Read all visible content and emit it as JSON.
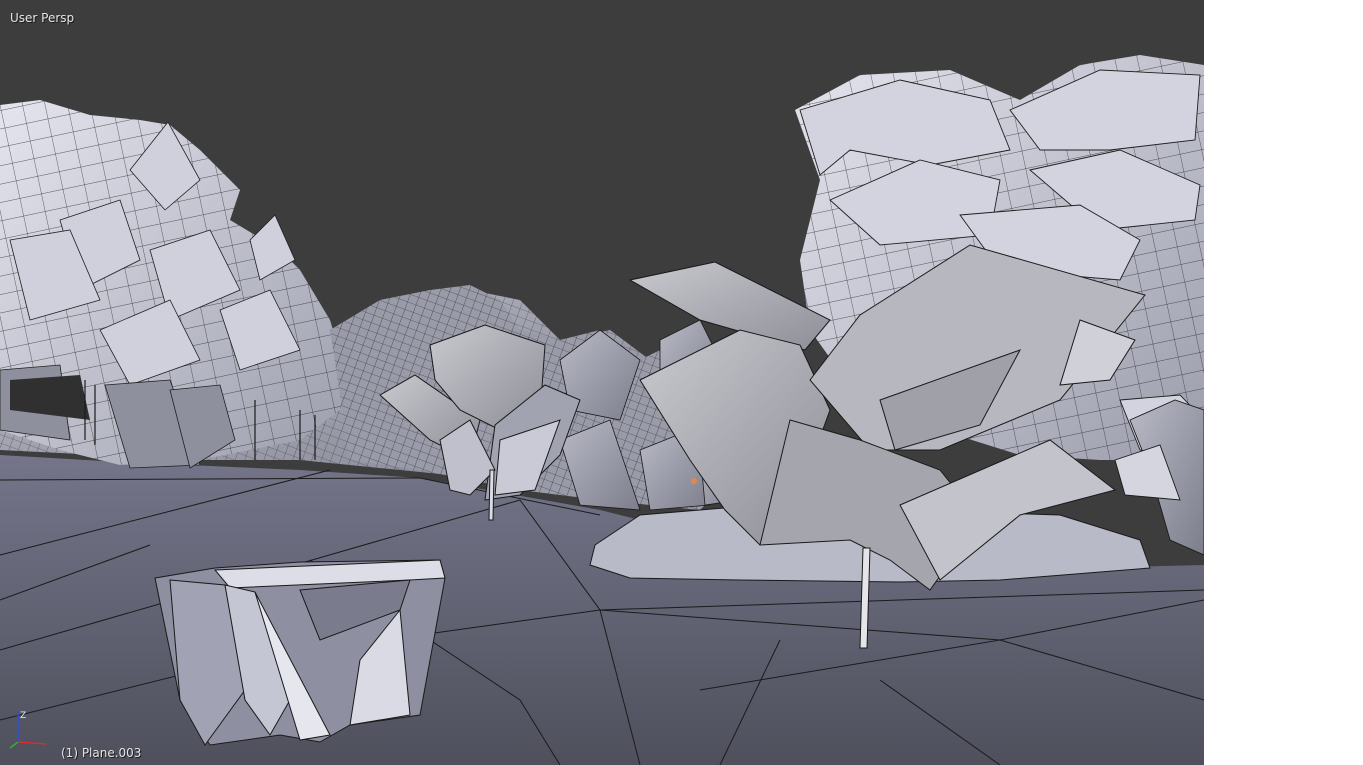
{
  "viewport": {
    "view_name": "User Persp",
    "object_name": "(1) Plane.003",
    "background_color": "#3d3d3d",
    "mesh_fill_color": "#a8a9b6",
    "mesh_light_color": "#d6d7e2",
    "mesh_dark_color": "#6f707c",
    "ground_color": "#5e5f6a",
    "wire_color": "#1c1c1c",
    "origin_color": "#e8864a"
  },
  "axis_gizmo": {
    "x_color": "#d03030",
    "y_color": "#30b030",
    "z_color": "#3050d0",
    "z_label": "Z"
  }
}
